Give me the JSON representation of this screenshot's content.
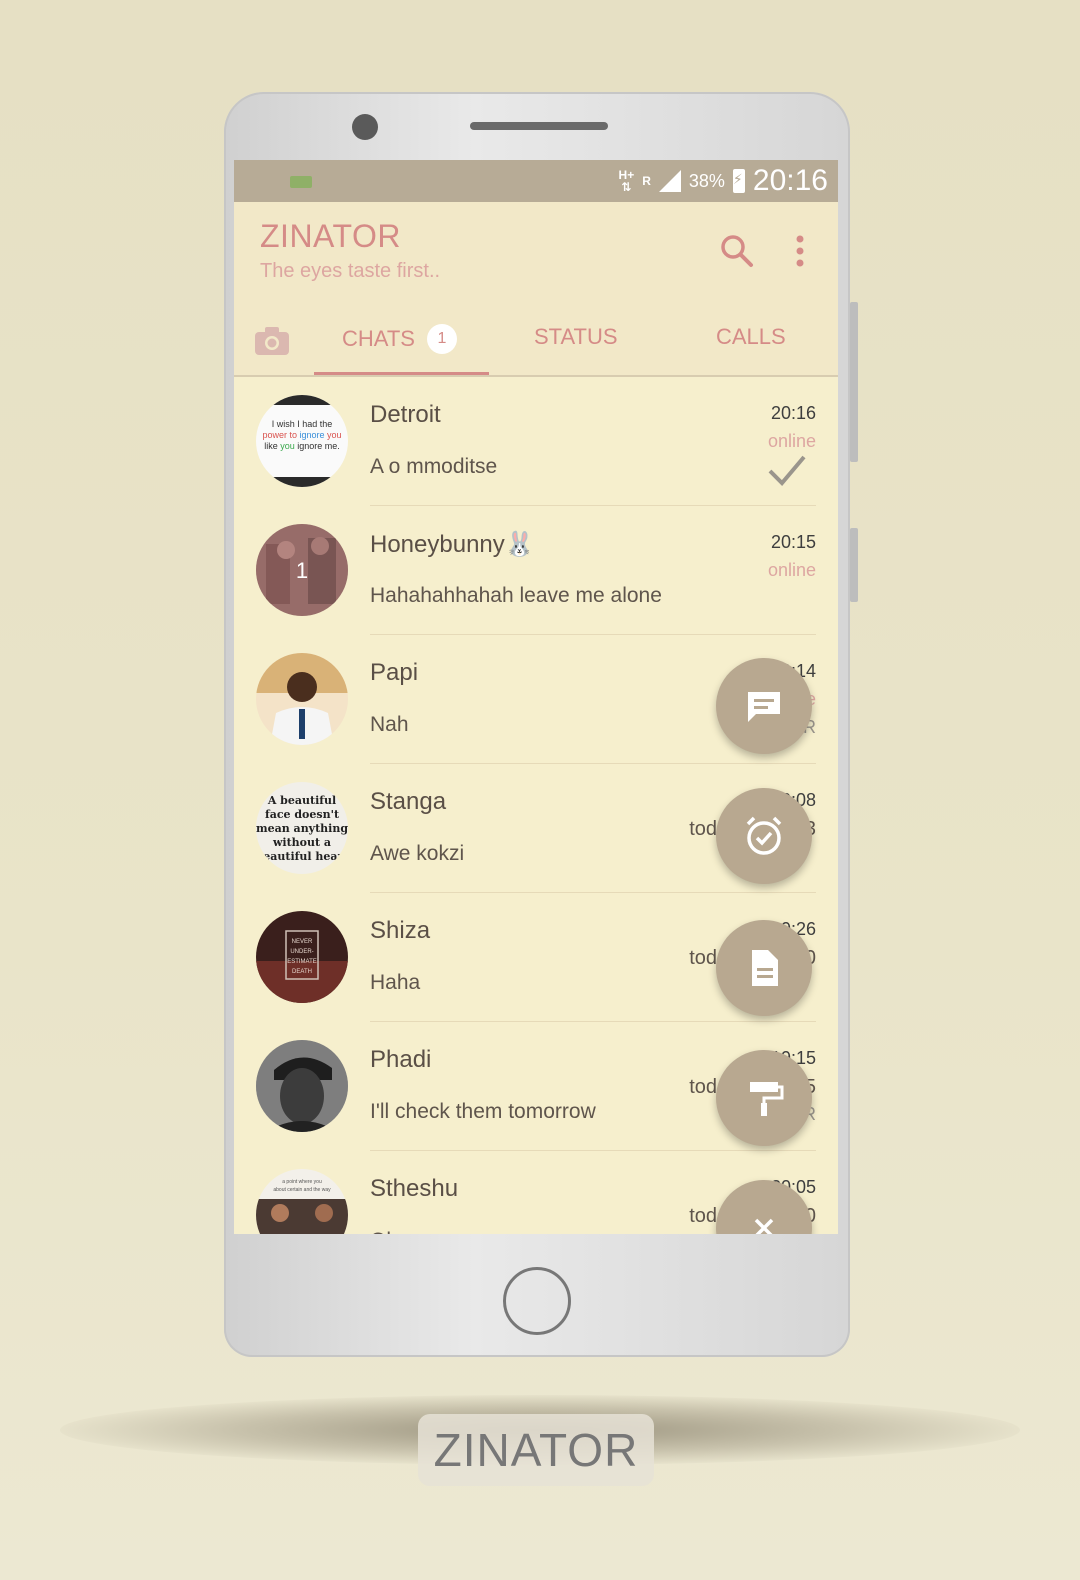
{
  "status_bar": {
    "network_type": "H+",
    "roaming": "R",
    "battery_percent": "38%",
    "time": "20:16"
  },
  "app": {
    "title": "ZINATOR",
    "subtitle": "The eyes taste first.."
  },
  "tabs": [
    {
      "label": "CHATS",
      "badge": "1",
      "active": true
    },
    {
      "label": "STATUS",
      "active": false
    },
    {
      "label": "CALLS",
      "active": false
    }
  ],
  "chats": [
    {
      "name": "Detroit",
      "message": "A o mmoditse",
      "time": "20:16",
      "presence": "online",
      "status_icon": "double-check-icon",
      "avatar_text": "I wish I had the power to ignore you like you ignore me."
    },
    {
      "name": "Honeybunny🐰",
      "message": "Hahahahhahah leave me alone",
      "time": "20:15",
      "presence": "online",
      "avatar_badge": "1"
    },
    {
      "name": "Papi",
      "message": "Nah",
      "time": "20:14",
      "presence": "online",
      "status_icon": "read-receipt-icon",
      "receipt_suffix": "R"
    },
    {
      "name": "Stanga",
      "message": "Awe kokzi",
      "time": "20:08",
      "last_seen": "today at 18:53",
      "avatar_text": "A beautiful face doesn't mean anything without a beautiful heart"
    },
    {
      "name": "Shiza",
      "message": "Haha",
      "time": "19:26",
      "last_seen": "today at 18:20",
      "avatar_text": "NEVER UNDER-ESTIMATE DEATH"
    },
    {
      "name": "Phadi",
      "message": "I'll check them tomorrow",
      "time": "19:15",
      "last_seen": "today at 20:15",
      "status_icon": "read-receipt-icon",
      "receipt_suffix": "R"
    },
    {
      "name": "Stheshu",
      "message": "Ok",
      "time": "20:05",
      "last_seen": "today at 20:00"
    }
  ],
  "fab_actions": [
    {
      "name": "new-chat-fab",
      "icon": "message-icon"
    },
    {
      "name": "reminder-fab",
      "icon": "alarm-check-icon"
    },
    {
      "name": "document-fab",
      "icon": "document-icon"
    },
    {
      "name": "theme-fab",
      "icon": "paint-roller-icon"
    },
    {
      "name": "close-fab",
      "icon": "close-icon"
    }
  ],
  "brand_label": "ZINATOR",
  "colors": {
    "accent": "#d58b87",
    "status_bar": "#b7ab96",
    "appbar": "#f2e8c8",
    "list_bg": "#f6efcd",
    "fab": "#b8a890"
  }
}
